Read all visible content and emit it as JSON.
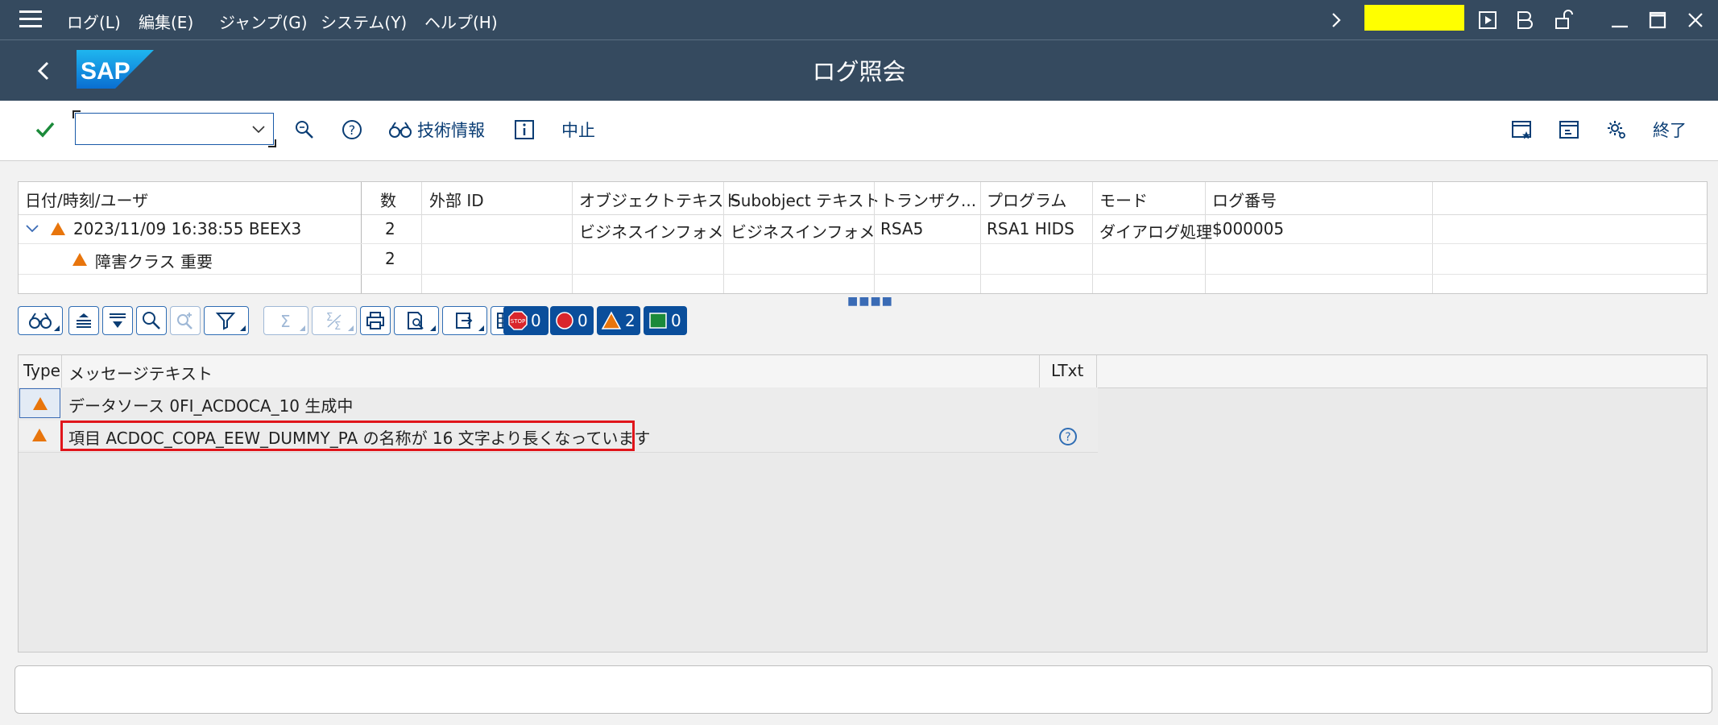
{
  "menubar": {
    "items": [
      "ログ(L)",
      "編集(E)",
      "ジャンプ(G)",
      "システム(Y)",
      "ヘルプ(H)"
    ]
  },
  "titlebar": {
    "title": "ログ照会",
    "logo_text": "SAP",
    "bg_color": "#354a5f"
  },
  "toolbar": {
    "command_value": "",
    "tech_info_label": "技術情報",
    "cancel_label": "中止",
    "exit_label": "終了"
  },
  "log_tree": {
    "columns": [
      "日付/時刻/ユーザ",
      "数",
      "外部 ID",
      "オブジェクトテキスト",
      "Subobject テキスト",
      "トランザク...",
      "プログラム",
      "モード",
      "ログ番号"
    ],
    "rows": [
      {
        "datetime_user": "2023/11/09  16:38:55  BEEX3",
        "count": "2",
        "external_id": "",
        "object_text": "ビジネスインフォメーシ",
        "subobject_text": "ビジネスインフォメーシ",
        "transaction": "RSA5",
        "program": "RSA1 HIDS",
        "mode": "ダイアログ処理",
        "log_number": "$000005"
      },
      {
        "datetime_user": "障害クラス 重要",
        "count": "2",
        "external_id": "",
        "object_text": "",
        "subobject_text": "",
        "transaction": "",
        "program": "",
        "mode": "",
        "log_number": ""
      }
    ]
  },
  "alv_toolbar": {
    "stop_count": "0",
    "error_count": "0",
    "warning_count": "2",
    "success_count": "0"
  },
  "messages": {
    "columns": [
      "Type",
      "メッセージテキスト",
      "LTxt"
    ],
    "rows": [
      {
        "type": "warning",
        "text": "データソース 0FI_ACDOCA_10 生成中",
        "ltxt": ""
      },
      {
        "type": "warning",
        "text": "項目 ACDOC_COPA_EEW_DUMMY_PA の名称が 16 文字より長くなっています",
        "ltxt": "help"
      }
    ]
  },
  "colors": {
    "warning": "#e8750c",
    "highlight": "#e0151b",
    "command_field": "#ffff00",
    "accent": "#0a4e9b"
  }
}
